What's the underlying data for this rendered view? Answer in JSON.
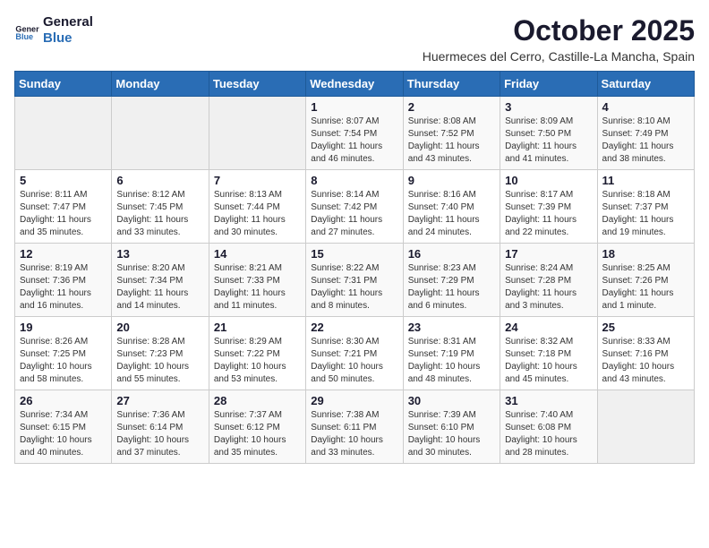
{
  "logo": {
    "line1": "General",
    "line2": "Blue"
  },
  "header": {
    "month": "October 2025",
    "location": "Huermeces del Cerro, Castille-La Mancha, Spain"
  },
  "weekdays": [
    "Sunday",
    "Monday",
    "Tuesday",
    "Wednesday",
    "Thursday",
    "Friday",
    "Saturday"
  ],
  "weeks": [
    [
      {
        "day": "",
        "info": ""
      },
      {
        "day": "",
        "info": ""
      },
      {
        "day": "",
        "info": ""
      },
      {
        "day": "1",
        "info": "Sunrise: 8:07 AM\nSunset: 7:54 PM\nDaylight: 11 hours and 46 minutes."
      },
      {
        "day": "2",
        "info": "Sunrise: 8:08 AM\nSunset: 7:52 PM\nDaylight: 11 hours and 43 minutes."
      },
      {
        "day": "3",
        "info": "Sunrise: 8:09 AM\nSunset: 7:50 PM\nDaylight: 11 hours and 41 minutes."
      },
      {
        "day": "4",
        "info": "Sunrise: 8:10 AM\nSunset: 7:49 PM\nDaylight: 11 hours and 38 minutes."
      }
    ],
    [
      {
        "day": "5",
        "info": "Sunrise: 8:11 AM\nSunset: 7:47 PM\nDaylight: 11 hours and 35 minutes."
      },
      {
        "day": "6",
        "info": "Sunrise: 8:12 AM\nSunset: 7:45 PM\nDaylight: 11 hours and 33 minutes."
      },
      {
        "day": "7",
        "info": "Sunrise: 8:13 AM\nSunset: 7:44 PM\nDaylight: 11 hours and 30 minutes."
      },
      {
        "day": "8",
        "info": "Sunrise: 8:14 AM\nSunset: 7:42 PM\nDaylight: 11 hours and 27 minutes."
      },
      {
        "day": "9",
        "info": "Sunrise: 8:16 AM\nSunset: 7:40 PM\nDaylight: 11 hours and 24 minutes."
      },
      {
        "day": "10",
        "info": "Sunrise: 8:17 AM\nSunset: 7:39 PM\nDaylight: 11 hours and 22 minutes."
      },
      {
        "day": "11",
        "info": "Sunrise: 8:18 AM\nSunset: 7:37 PM\nDaylight: 11 hours and 19 minutes."
      }
    ],
    [
      {
        "day": "12",
        "info": "Sunrise: 8:19 AM\nSunset: 7:36 PM\nDaylight: 11 hours and 16 minutes."
      },
      {
        "day": "13",
        "info": "Sunrise: 8:20 AM\nSunset: 7:34 PM\nDaylight: 11 hours and 14 minutes."
      },
      {
        "day": "14",
        "info": "Sunrise: 8:21 AM\nSunset: 7:33 PM\nDaylight: 11 hours and 11 minutes."
      },
      {
        "day": "15",
        "info": "Sunrise: 8:22 AM\nSunset: 7:31 PM\nDaylight: 11 hours and 8 minutes."
      },
      {
        "day": "16",
        "info": "Sunrise: 8:23 AM\nSunset: 7:29 PM\nDaylight: 11 hours and 6 minutes."
      },
      {
        "day": "17",
        "info": "Sunrise: 8:24 AM\nSunset: 7:28 PM\nDaylight: 11 hours and 3 minutes."
      },
      {
        "day": "18",
        "info": "Sunrise: 8:25 AM\nSunset: 7:26 PM\nDaylight: 11 hours and 1 minute."
      }
    ],
    [
      {
        "day": "19",
        "info": "Sunrise: 8:26 AM\nSunset: 7:25 PM\nDaylight: 10 hours and 58 minutes."
      },
      {
        "day": "20",
        "info": "Sunrise: 8:28 AM\nSunset: 7:23 PM\nDaylight: 10 hours and 55 minutes."
      },
      {
        "day": "21",
        "info": "Sunrise: 8:29 AM\nSunset: 7:22 PM\nDaylight: 10 hours and 53 minutes."
      },
      {
        "day": "22",
        "info": "Sunrise: 8:30 AM\nSunset: 7:21 PM\nDaylight: 10 hours and 50 minutes."
      },
      {
        "day": "23",
        "info": "Sunrise: 8:31 AM\nSunset: 7:19 PM\nDaylight: 10 hours and 48 minutes."
      },
      {
        "day": "24",
        "info": "Sunrise: 8:32 AM\nSunset: 7:18 PM\nDaylight: 10 hours and 45 minutes."
      },
      {
        "day": "25",
        "info": "Sunrise: 8:33 AM\nSunset: 7:16 PM\nDaylight: 10 hours and 43 minutes."
      }
    ],
    [
      {
        "day": "26",
        "info": "Sunrise: 7:34 AM\nSunset: 6:15 PM\nDaylight: 10 hours and 40 minutes."
      },
      {
        "day": "27",
        "info": "Sunrise: 7:36 AM\nSunset: 6:14 PM\nDaylight: 10 hours and 37 minutes."
      },
      {
        "day": "28",
        "info": "Sunrise: 7:37 AM\nSunset: 6:12 PM\nDaylight: 10 hours and 35 minutes."
      },
      {
        "day": "29",
        "info": "Sunrise: 7:38 AM\nSunset: 6:11 PM\nDaylight: 10 hours and 33 minutes."
      },
      {
        "day": "30",
        "info": "Sunrise: 7:39 AM\nSunset: 6:10 PM\nDaylight: 10 hours and 30 minutes."
      },
      {
        "day": "31",
        "info": "Sunrise: 7:40 AM\nSunset: 6:08 PM\nDaylight: 10 hours and 28 minutes."
      },
      {
        "day": "",
        "info": ""
      }
    ]
  ]
}
